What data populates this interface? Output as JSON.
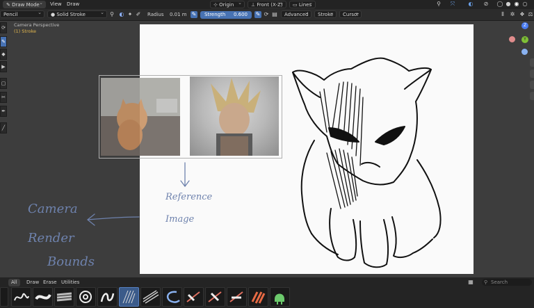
{
  "header": {
    "mode": "Draw Mode",
    "menus": [
      "View",
      "Draw"
    ],
    "pivot": "Origin",
    "view": "Front (X-Z)",
    "stroke_type": "Lines"
  },
  "tool_settings": {
    "brush": "Pencil",
    "stroke_style": "Solid Stroke",
    "radius_label": "Radius",
    "radius_value": "0.01 m",
    "strength_label": "Strength",
    "strength_value": "0.600",
    "advanced": "Advanced",
    "stroke": "Stroke",
    "cursor": "Cursor"
  },
  "viewport": {
    "camera_label": "Camera Perspective",
    "object_label": "(1) Stroke"
  },
  "annotations": {
    "line1": "Camera",
    "line2": "Render",
    "line3": "Bounds",
    "ref1": "Reference",
    "ref2": "Image"
  },
  "asset_tabs": [
    "All",
    "Draw",
    "Erase",
    "Utilities"
  ],
  "search_placeholder": "Search",
  "gizmo": {
    "z": "Z",
    "y": "Y"
  },
  "colors": {
    "accent": "#4772b3",
    "toolbar": "#2c2c2c",
    "canvas": "#fafafa",
    "ink": "#111111"
  }
}
